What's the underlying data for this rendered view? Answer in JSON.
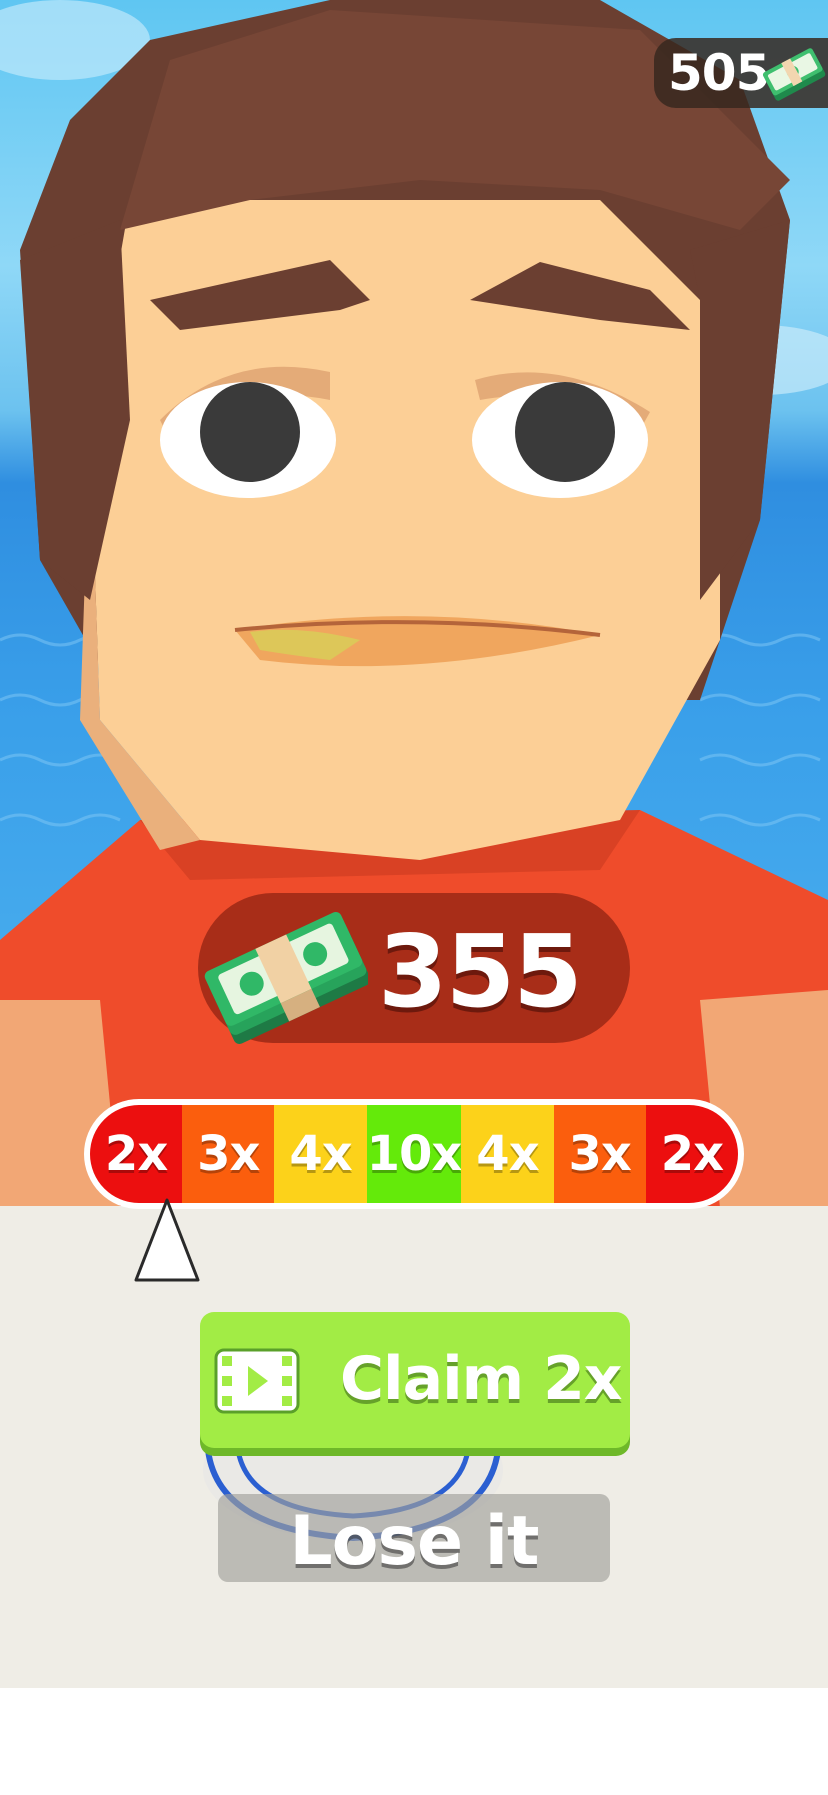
{
  "hud": {
    "coin_total": "505",
    "money_icon": "cash-stack-icon"
  },
  "reward": {
    "amount": "355",
    "icon": "cash-stack-icon"
  },
  "multiplier_bar": {
    "segments": [
      {
        "label": "2x",
        "color": "#ec0f0f"
      },
      {
        "label": "3x",
        "color": "#fb5e0d"
      },
      {
        "label": "4x",
        "color": "#fcd21a"
      },
      {
        "label": "10x",
        "color": "#64ea0a"
      },
      {
        "label": "4x",
        "color": "#fcd21a"
      },
      {
        "label": "3x",
        "color": "#fb5e0d"
      },
      {
        "label": "2x",
        "color": "#ec0f0f"
      }
    ],
    "pointer_segment_index": 0
  },
  "buttons": {
    "claim_label": "Claim 2x",
    "claim_icon": "video-ad-icon",
    "lose_label": "Lose it"
  },
  "colors": {
    "claim_green": "#a2ec45",
    "panel_bg": "#efede6",
    "skin": "#fccf96",
    "hair": "#6e4032",
    "shirt": "#ee4a2a"
  }
}
